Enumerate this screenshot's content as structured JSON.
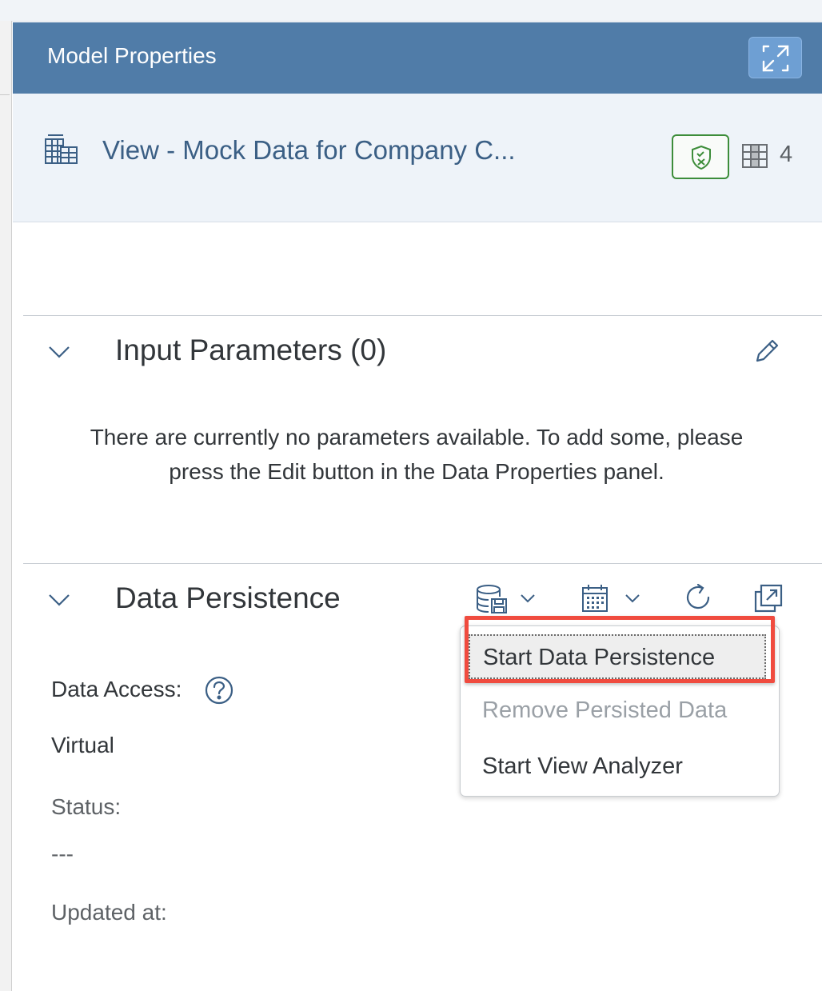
{
  "header": {
    "title": "Model Properties",
    "expand_icon": "expand-icon"
  },
  "object": {
    "title": "View - Mock Data for Company C...",
    "icon": "view-table-icon",
    "badge_icon": "shield-icon",
    "columns_icon": "columns-icon",
    "columns_count": "4"
  },
  "input_parameters": {
    "title": "Input Parameters (0)",
    "empty_text": "There are currently no parameters available. To add some, please press the Edit button in the Data Properties panel."
  },
  "data_persistence": {
    "title": "Data Persistence",
    "data_access_label": "Data Access:",
    "data_access_value": "Virtual",
    "status_label": "Status:",
    "status_value": "---",
    "updated_label": "Updated at:"
  },
  "menu": {
    "items": [
      {
        "label": "Start Data Persistence",
        "state": "selected"
      },
      {
        "label": "Remove Persisted Data",
        "state": "disabled"
      },
      {
        "label": "Start View Analyzer",
        "state": "enabled"
      }
    ]
  },
  "colors": {
    "header_bg": "#507ca8",
    "accent": "#3b5f85",
    "badge": "#3d8d3a",
    "highlight": "#f04b3f"
  }
}
